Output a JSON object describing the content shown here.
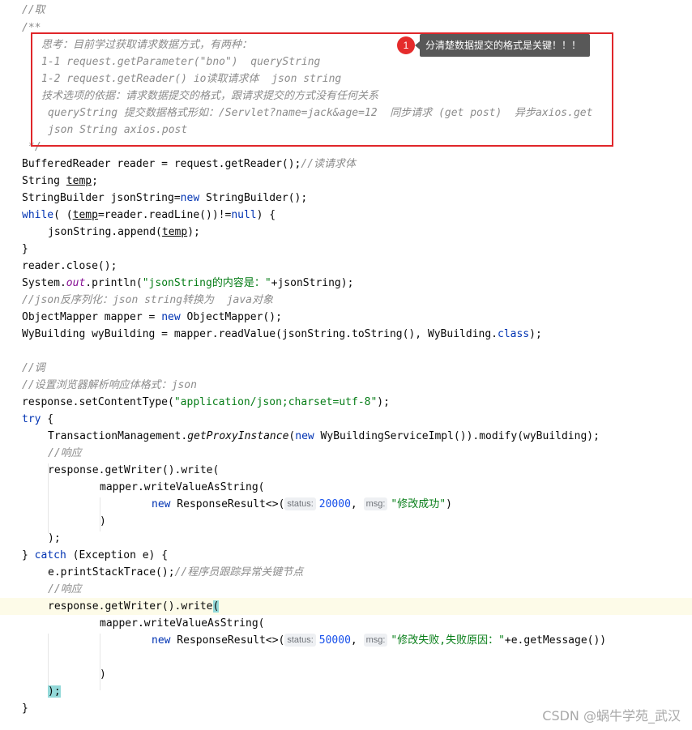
{
  "annotation": {
    "badge": "1",
    "tooltip": "分清楚数据提交的格式是关键！！！"
  },
  "code": {
    "l1": "//取",
    "l2": "/**",
    "l3": "思考：目前学过获取请求数据方式，有两种：",
    "l4": "1-1 request.getParameter(\"bno\")  queryString",
    "l5": "1-2 request.getReader() io读取请求体  json string",
    "l6": "技术选项的依据：请求数据提交的格式，跟请求提交的方式没有任何关系",
    "l7": "queryString 提交数据格式形如：/Servlet?name=jack&age=12  同步请求 (get post)  异步axios.get",
    "l8": "json String axios.post",
    "l9": "*/",
    "l10a": "BufferedReader reader = request.getReader();",
    "l10b": "//读请求体",
    "l11a": "String ",
    "l11b": "temp",
    "l11c": ";",
    "l12a": "StringBuilder jsonString=",
    "l12b": "new",
    "l12c": " StringBuilder();",
    "l13a": "while",
    "l13b": "( (",
    "l13c": "temp",
    "l13d": "=reader.readLine())!=",
    "l13e": "null",
    "l13f": ") {",
    "l14a": "jsonString.append(",
    "l14b": "temp",
    "l14c": ");",
    "l15": "}",
    "l16": "reader.close();",
    "l17a": "System.",
    "l17b": "out",
    "l17c": ".println(",
    "l17d": "\"jsonString的内容是：\"",
    "l17e": "+jsonString);",
    "l18": "//json反序列化：json string转换为  java对象",
    "l19a": "ObjectMapper mapper = ",
    "l19b": "new",
    "l19c": " ObjectMapper();",
    "l20a": "WyBuilding wyBuilding = mapper.readValue(jsonString.toString(), WyBuilding.",
    "l20b": "class",
    "l20c": ");",
    "l22": "//调",
    "l23": "//设置浏览器解析响应体格式：json",
    "l24a": "response.setContentType(",
    "l24b": "\"application/json;charset=utf-8\"",
    "l24c": ");",
    "l25a": "try",
    "l25b": " {",
    "l26a": "TransactionManagement.",
    "l26b": "getProxyInstance",
    "l26c": "(",
    "l26d": "new",
    "l26e": " WyBuildingServiceImpl()).modify(wyBuilding);",
    "l27": "//响应",
    "l28": "response.getWriter().write(",
    "l29": "mapper.writeValueAsString(",
    "l30a": "new",
    "l30b": " ResponseResult<>(",
    "l30h1": "status:",
    "l30c": "20000",
    "l30d": ", ",
    "l30h2": "msg:",
    "l30e": "\"修改成功\"",
    "l30f": ")",
    "l31": ")",
    "l32": ");",
    "l33a": "} ",
    "l33b": "catch",
    "l33c": " (Exception e) {",
    "l34a": "e.printStackTrace();",
    "l34b": "//程序员跟踪异常关键节点",
    "l35": "//响应",
    "l36a": "response.getWriter().write",
    "l36b": "(",
    "l37": "mapper.writeValueAsString(",
    "l38a": "new",
    "l38b": " ResponseResult<>(",
    "l38h1": "status:",
    "l38c": "50000",
    "l38d": ", ",
    "l38h2": "msg:",
    "l38e": "\"修改失败,失败原因：\"",
    "l38f": "+e.getMessage())",
    "l40": ")",
    "l41": ");",
    "l42": "}"
  },
  "watermark": "CSDN @蜗牛学苑_武汉"
}
